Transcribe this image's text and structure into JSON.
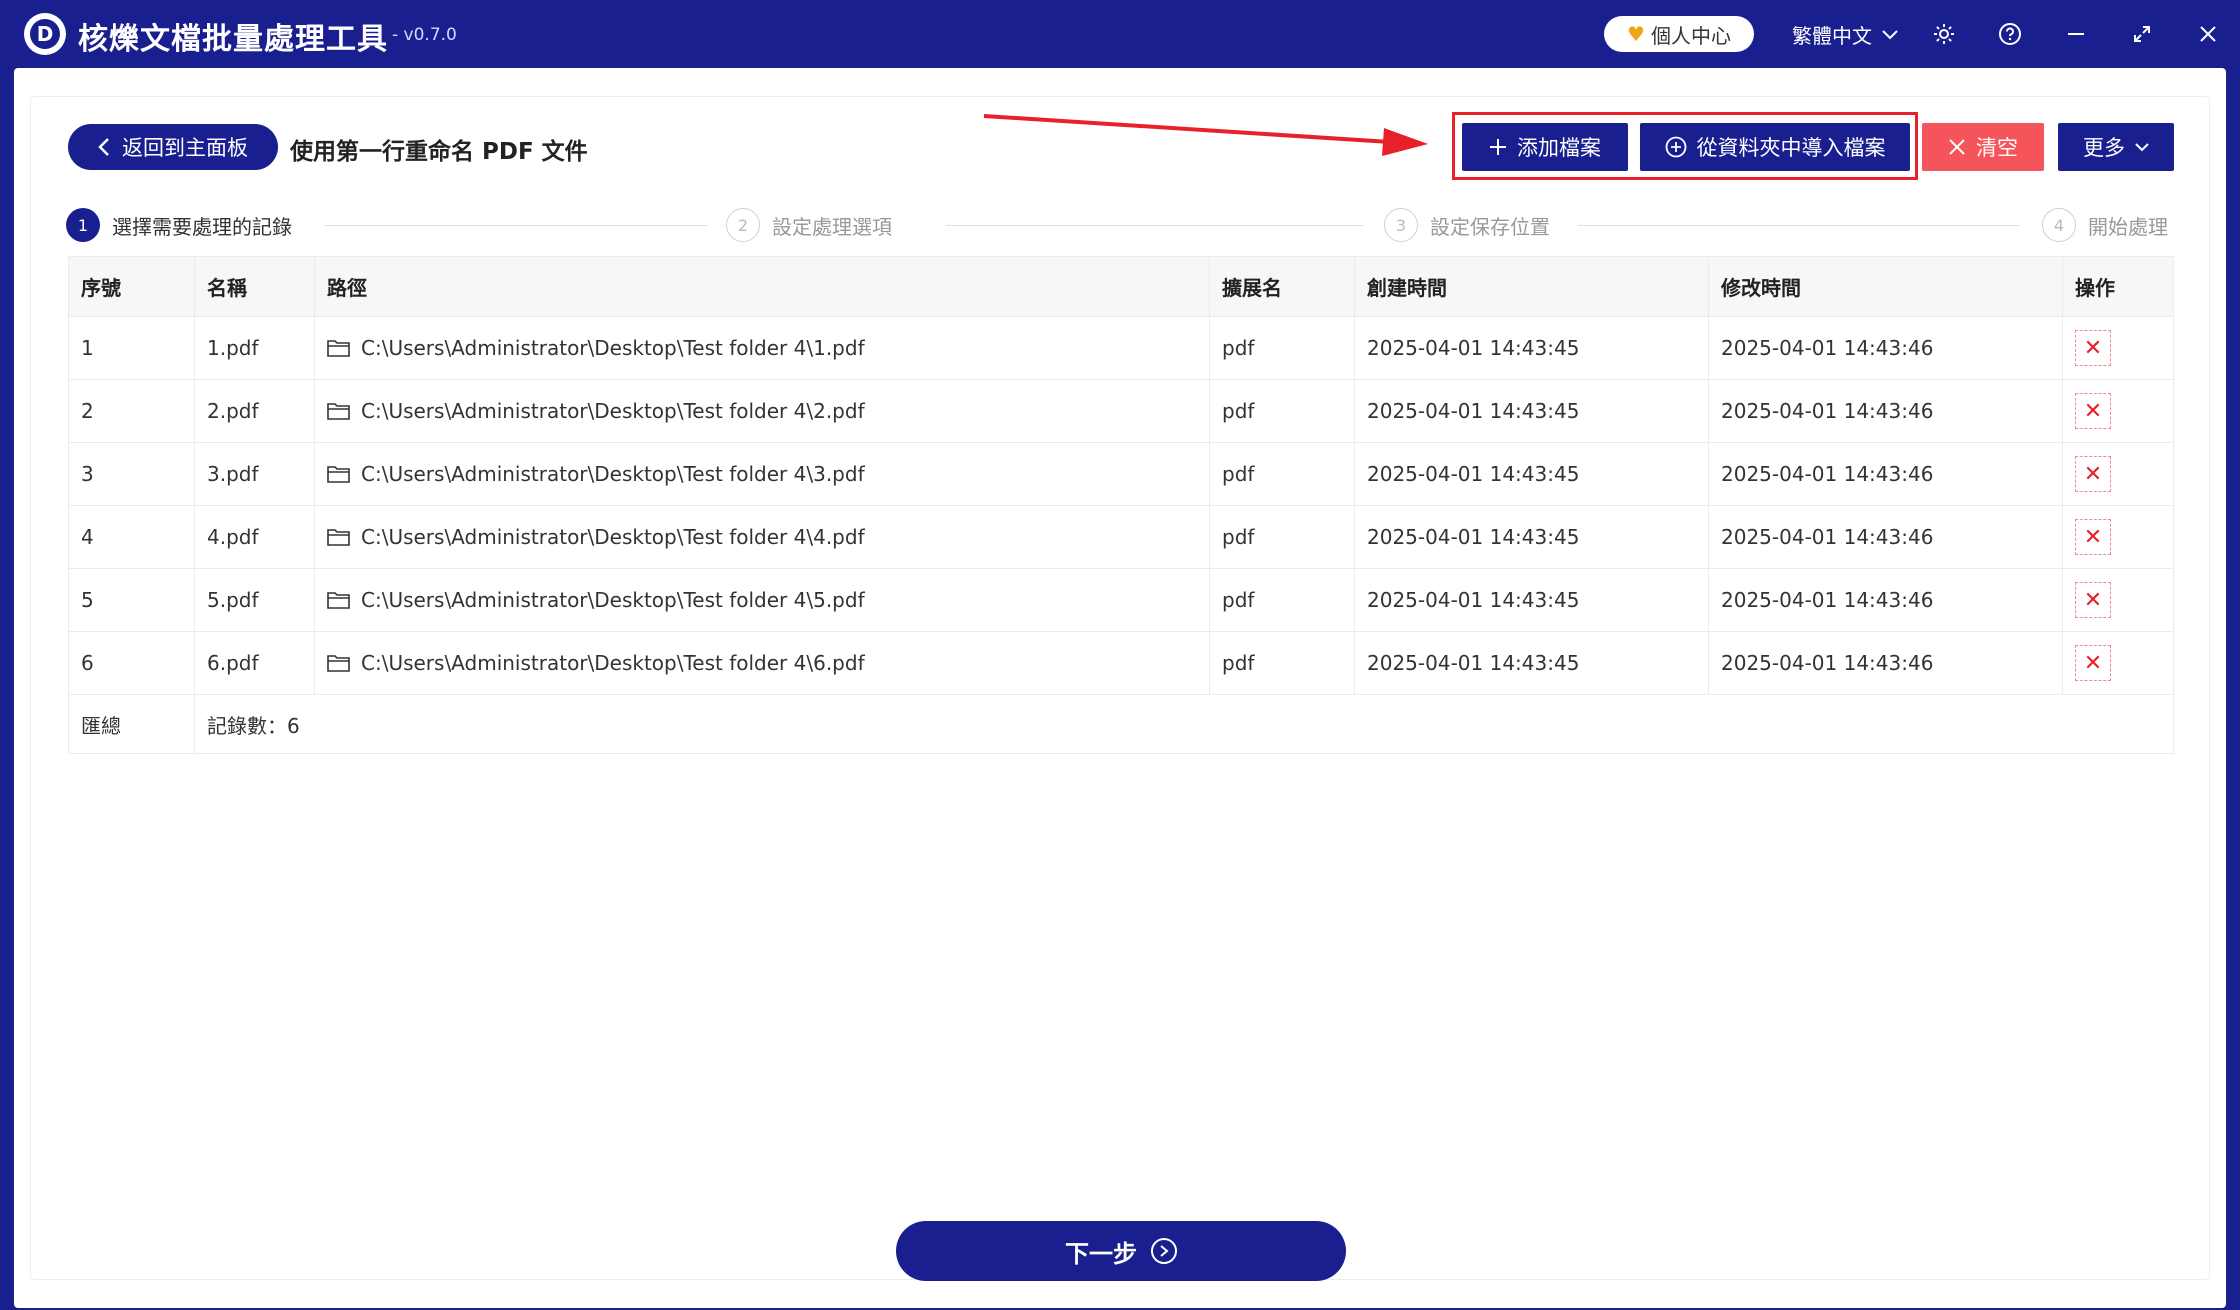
{
  "app": {
    "title": "核爍文檔批量處理工具",
    "version": "- v0.7.0",
    "logo_letter": "D",
    "profile_label": "個人中心",
    "language": "繁體中文"
  },
  "toolbar": {
    "back_label": "返回到主面板",
    "page_title": "使用第一行重命名 PDF 文件",
    "add_file_label": "添加檔案",
    "import_folder_label": "從資料夾中導入檔案",
    "clear_label": "清空",
    "more_label": "更多"
  },
  "steps": [
    {
      "num": "1",
      "label": "選擇需要處理的記錄"
    },
    {
      "num": "2",
      "label": "設定處理選項"
    },
    {
      "num": "3",
      "label": "設定保存位置"
    },
    {
      "num": "4",
      "label": "開始處理"
    }
  ],
  "table": {
    "headers": [
      "序號",
      "名稱",
      "路徑",
      "擴展名",
      "創建時間",
      "修改時間",
      "操作"
    ],
    "rows": [
      {
        "idx": "1",
        "name": "1.pdf",
        "path": "C:\\Users\\Administrator\\Desktop\\Test folder 4\\1.pdf",
        "ext": "pdf",
        "created": "2025-04-01 14:43:45",
        "modified": "2025-04-01 14:43:46"
      },
      {
        "idx": "2",
        "name": "2.pdf",
        "path": "C:\\Users\\Administrator\\Desktop\\Test folder 4\\2.pdf",
        "ext": "pdf",
        "created": "2025-04-01 14:43:45",
        "modified": "2025-04-01 14:43:46"
      },
      {
        "idx": "3",
        "name": "3.pdf",
        "path": "C:\\Users\\Administrator\\Desktop\\Test folder 4\\3.pdf",
        "ext": "pdf",
        "created": "2025-04-01 14:43:45",
        "modified": "2025-04-01 14:43:46"
      },
      {
        "idx": "4",
        "name": "4.pdf",
        "path": "C:\\Users\\Administrator\\Desktop\\Test folder 4\\4.pdf",
        "ext": "pdf",
        "created": "2025-04-01 14:43:45",
        "modified": "2025-04-01 14:43:46"
      },
      {
        "idx": "5",
        "name": "5.pdf",
        "path": "C:\\Users\\Administrator\\Desktop\\Test folder 4\\5.pdf",
        "ext": "pdf",
        "created": "2025-04-01 14:43:45",
        "modified": "2025-04-01 14:43:46"
      },
      {
        "idx": "6",
        "name": "6.pdf",
        "path": "C:\\Users\\Administrator\\Desktop\\Test folder 4\\6.pdf",
        "ext": "pdf",
        "created": "2025-04-01 14:43:45",
        "modified": "2025-04-01 14:43:46"
      }
    ],
    "summary_label": "匯總",
    "summary_value": "記錄數：6"
  },
  "footer": {
    "next_label": "下一步"
  },
  "colors": {
    "brand": "#1a1f8f",
    "danger": "#f4545a",
    "annotation": "#e8202a"
  }
}
